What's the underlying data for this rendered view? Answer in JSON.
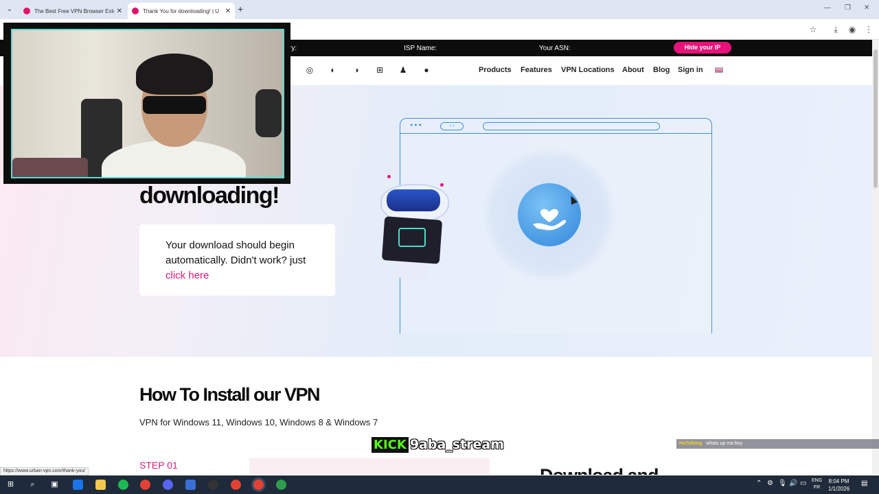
{
  "browser": {
    "tabs": [
      {
        "title": "The Best Free VPN Browser Exte"
      },
      {
        "title": "Thank You for downloading! | U"
      }
    ],
    "new_tab_symbol": "+"
  },
  "topbar": {
    "country_label": "ry:",
    "isp_label": "ISP Name:",
    "asn_label": "Your ASN:",
    "hide_ip_button": "Hide your IP"
  },
  "nav": {
    "os_icons": [
      "chrome-icon",
      "firefox-icon",
      "edge-icon",
      "windows-icon",
      "android-icon",
      "apple-icon"
    ],
    "links": [
      "Products",
      "Features",
      "VPN Locations",
      "About",
      "Blog",
      "Sign in"
    ]
  },
  "hero": {
    "title_visible": "downloading!",
    "card_text": "Your download should begin automatically. Didn't work? just",
    "card_link": "click here"
  },
  "install": {
    "title": "How To Install our VPN",
    "subtitle": "VPN for Windows 11, Windows 10, Windows 8 & Windows 7",
    "step": "STEP 01",
    "next_heading_partial": "Download and"
  },
  "status_url": "https://www.urban-vpn.com/thank-you/",
  "stream": {
    "kick_logo": "KICK",
    "handle": "9aba_stream",
    "chat_user": "HaTolking",
    "chat_message": "whats up ma boy"
  },
  "taskbar": {
    "lang_top": "ENG",
    "lang_bottom": "FR",
    "time": "8:04 PM",
    "date": "1/1/2026"
  },
  "colors": {
    "accent_pink": "#e7127a",
    "link_pink": "#d81b7a",
    "mock_blue": "#3f8ee6",
    "kick_green": "#53fc18"
  }
}
